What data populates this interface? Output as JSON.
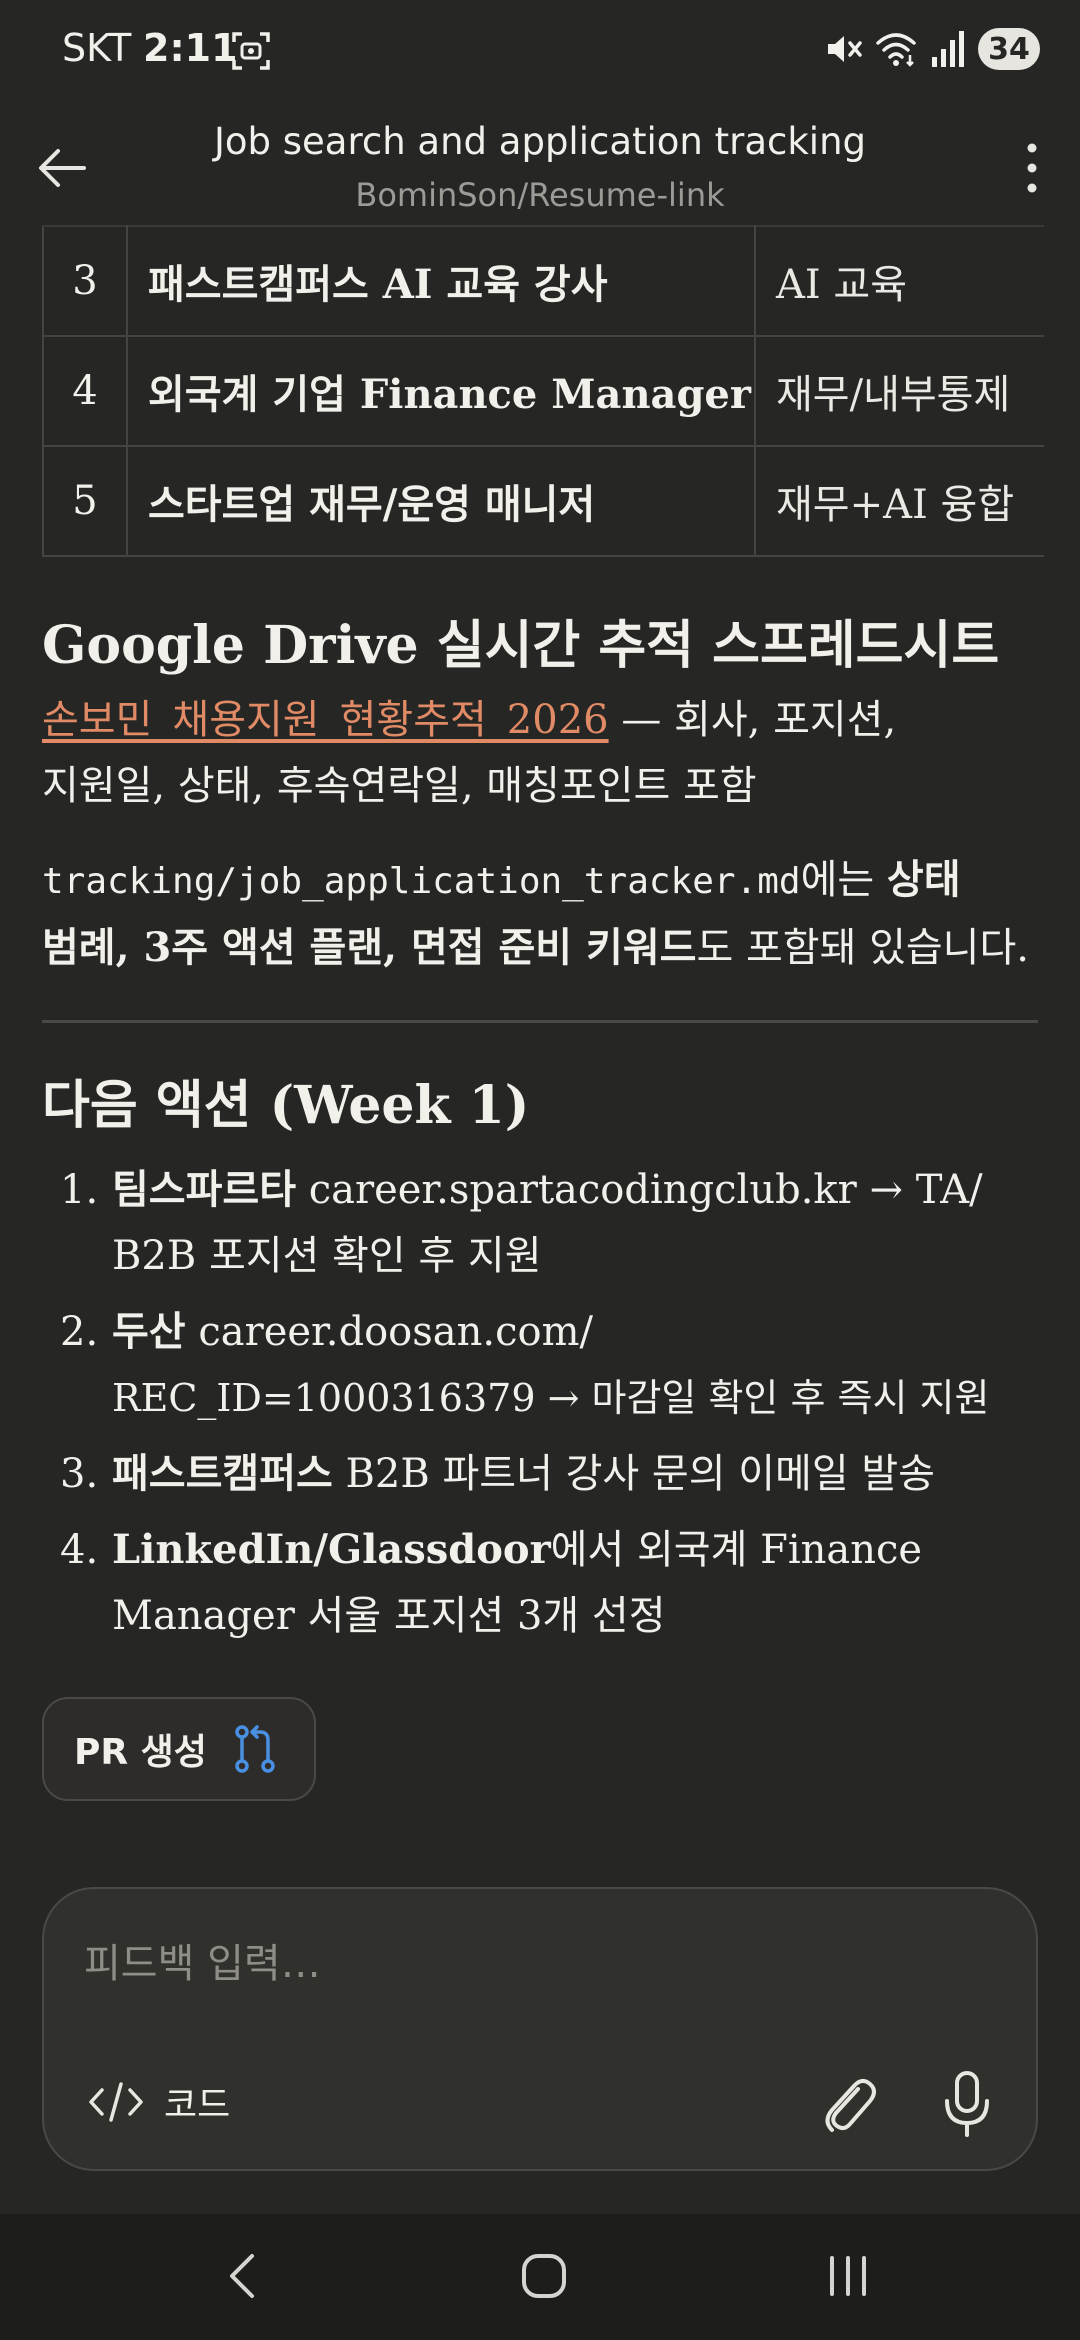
{
  "status_bar": {
    "carrier": "SKT",
    "time": "2:11",
    "battery": "34"
  },
  "header": {
    "title": "Job search and application tracking",
    "subtitle": "BominSon/Resume-link"
  },
  "table": {
    "rows": [
      {
        "num": "3",
        "role": "패스트캠퍼스 AI 교육 강사",
        "area": "AI 교육"
      },
      {
        "num": "4",
        "role": "외국계 기업 Finance Manager",
        "area": "재무/내부통제"
      },
      {
        "num": "5",
        "role": "스타트업 재무/운영 매니저",
        "area": "재무+AI 융합"
      }
    ]
  },
  "drive": {
    "heading": "Google Drive 실시간 추적 스프레드시트",
    "link": "손보민_채용지원_현황추적_2026",
    "desc_line1": " — 회사, 포지션,",
    "desc_line2": "지원일, 상태, 후속연락일, 매칭포인트 포함"
  },
  "tracker": {
    "path": "tracking/job_application_tracker.md",
    "text1": "에는 ",
    "bold1": "상태",
    "bold2": "범례, 3주 액션 플랜, 면접 준비 키워드",
    "text2": "도 포함돼 있습니다."
  },
  "next_actions": {
    "heading": "다음 액션 (Week 1)",
    "items": [
      {
        "num": "1.",
        "bold": "팀스파르타",
        "line1": " career.spartacodingclub.kr → TA/",
        "line2": "B2B 포지션 확인 후 지원"
      },
      {
        "num": "2.",
        "bold": "두산",
        "line1": " career.doosan.com/",
        "line2": "REC_ID=1000316379 → 마감일 확인 후 즉시 지원"
      },
      {
        "num": "3.",
        "bold": "패스트캠퍼스",
        "line1": " B2B 파트너 강사 문의 이메일 발송",
        "line2": ""
      },
      {
        "num": "4.",
        "bold": "LinkedIn/Glassdoor",
        "line1": "에서 외국계 Finance",
        "line2": "Manager 서울 포지션 3개 선정"
      }
    ]
  },
  "pr_button": {
    "label": "PR 생성"
  },
  "composer": {
    "placeholder": "피드백 입력…",
    "code_label": "코드"
  },
  "colors": {
    "background": "#262624",
    "link": "#e08a66",
    "pr_icon": "#4a90e2"
  },
  "icons": [
    "back-arrow-icon",
    "more-vertical-icon",
    "git-pull-request-icon",
    "code-icon",
    "paperclip-icon",
    "microphone-icon",
    "mute-icon",
    "wifi-icon",
    "signal-icon"
  ]
}
